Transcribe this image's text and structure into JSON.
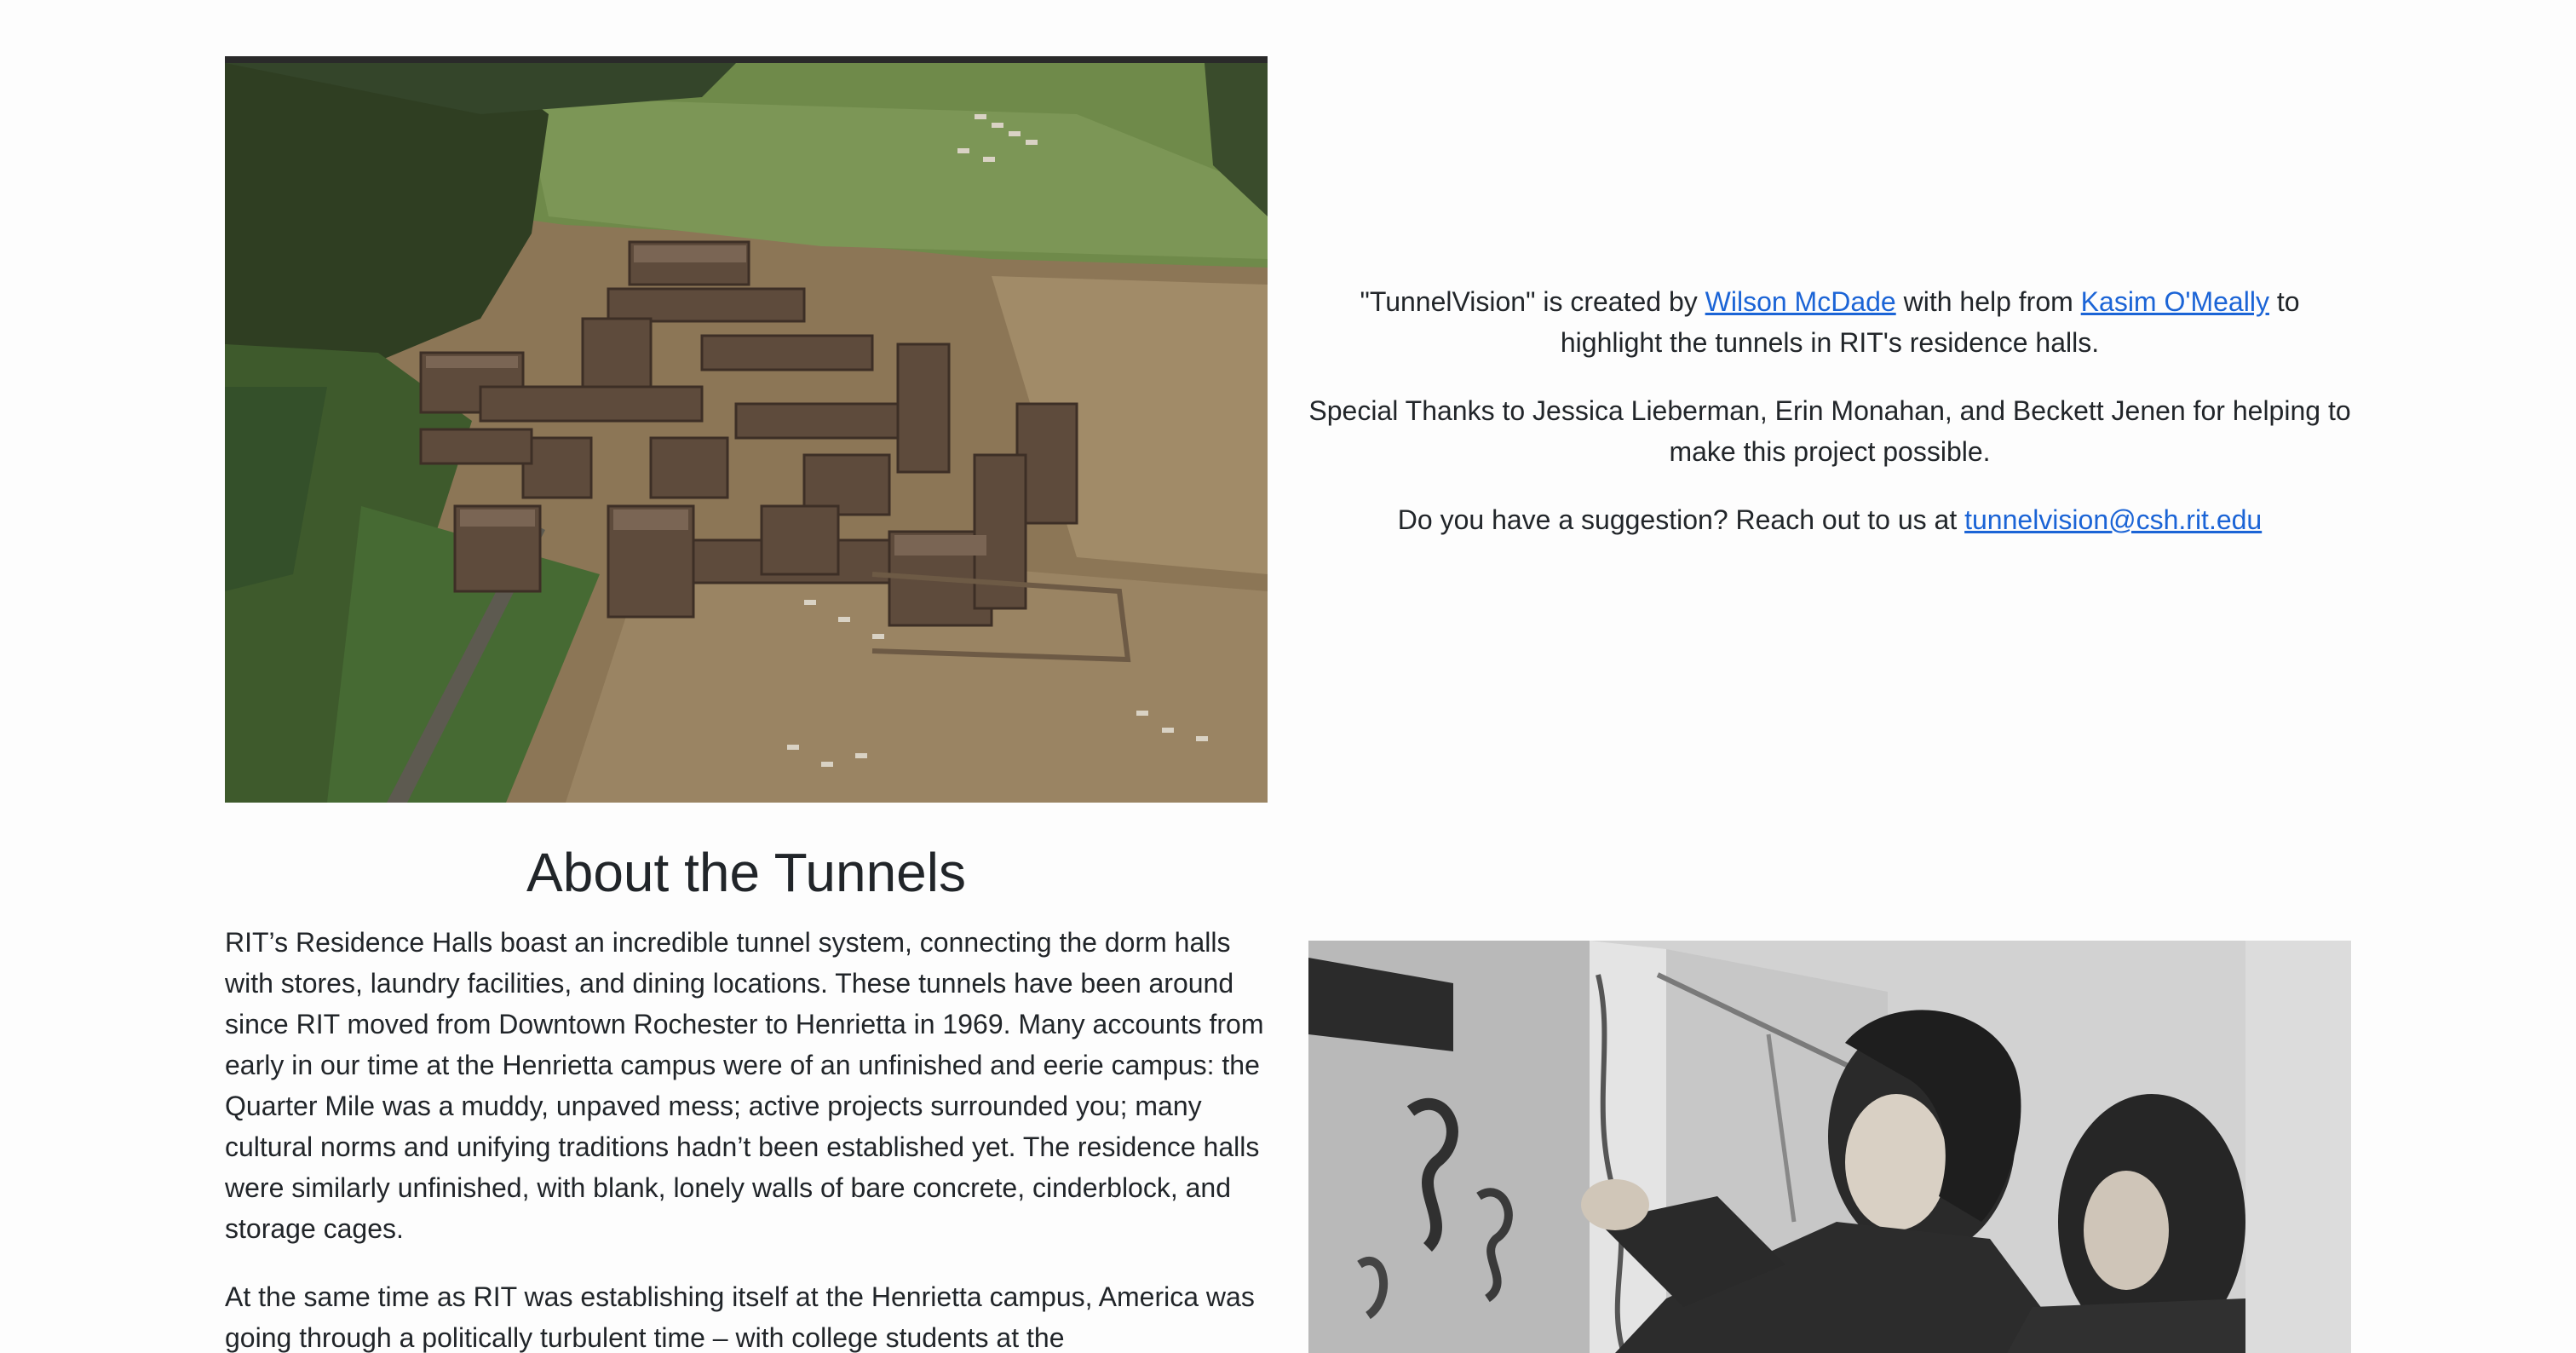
{
  "images": {
    "aerial": "aerial-construction-photo",
    "bw": "students-painting-photo"
  },
  "credits": {
    "line1_prefix": "\"TunnelVision\" is created by ",
    "creator_link": "Wilson McDade",
    "line1_middle": " with help from ",
    "helper_link": "Kasim O'Meally",
    "line1_suffix": " to highlight the tunnels in RIT's residence halls.",
    "thanks": "Special Thanks to Jessica Lieberman, Erin Monahan, and Beckett Jenen for helping to make this project possible.",
    "suggestion_prefix": "Do you have a suggestion? Reach out to us at ",
    "email_link": "tunnelvision@csh.rit.edu"
  },
  "about": {
    "title": "About the Tunnels",
    "paragraph1": "RIT’s Residence Halls boast an incredible tunnel system, connecting the dorm halls with stores, laundry facilities, and dining locations. These tunnels have been around since RIT moved from Downtown Rochester to Henrietta in 1969. Many accounts from early in our time at the Henrietta campus were of an unfinished and eerie campus: the Quarter Mile was a muddy, unpaved mess; active projects surrounded you; many cultural norms and unifying traditions hadn’t been established yet. The residence halls were similarly unfinished, with blank, lonely walls of bare concrete, cinderblock, and storage cages.",
    "paragraph2": "At the same time as RIT was establishing itself at the Henrietta campus, America was going through a politically turbulent time – with college students at the"
  },
  "colors": {
    "link": "#1b64d6",
    "text": "#212529",
    "background": "#fdfdfd"
  }
}
